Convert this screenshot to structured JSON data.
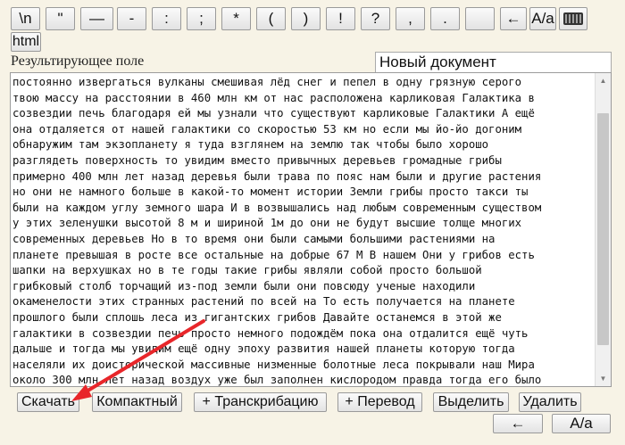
{
  "toolbar": {
    "symbols": [
      "\\n",
      "\"",
      "—",
      "-",
      ":",
      ";",
      "*",
      "(",
      ")",
      "!",
      "?",
      ",",
      ".",
      "",
      "←",
      "A/a"
    ],
    "html_label": "html"
  },
  "result_label": "Результирующее поле",
  "doc_title": "Новый документ",
  "text_lines": [
    "постоянно извергаться вулканы смешивая лёд снег и пепел в одну грязную серого",
    "твою массу на расстоянии в 460 млн км от нас расположена карликовая Галактика в",
    "созвездии печь благодаря ей мы узнали что существуют карликовые Галактики А ещё",
    "она отдаляется от нашей галактики со скоростью 53 км но если мы йо-йо догоним",
    "обнаружим там экзопланету я туда взглянем на землю так чтобы было хорошо",
    "разглядеть поверхность то увидим вместо привычных деревьев громадные грибы",
    "примерно 400 млн лет назад деревья были трава по пояс нам были и другие растения",
    "но они не намного больше в какой-то момент истории Земли грибы просто такси ты",
    "были на каждом углу земного шара И в возвышались над любым современным существом",
    "у этих зеленушки высотой 8 м и шириной 1м до они не будут высшие толще многих",
    "современных деревьев Но в то время они были самыми большими растениями на",
    "планете превышая в росте все остальные на добрые 67 М В нашем Они у грибов есть",
    "шапки на верхушках но в те годы такие грибы являли собой просто большой",
    "грибковый столб торчащий из-под земли были они повсюду ученые находили",
    "окаменелости этих странных растений по всей на То есть получается на планете",
    "прошлого были сплошь леса из гигантских грибов Давайте останемся в этой же",
    "галактики в созвездии печь просто немного подождём пока она отдалится ещё чуть",
    "дальше и тогда мы увидим ещё одну эпоху развития нашей планеты которую тогда",
    "населяли их доисторической массивные низменные болотные леса покрывали наш Мира",
    "около 300 млн лет назад воздух уже был заполнен кислородом правда тогда его было"
  ],
  "actions": {
    "download": "Скачать",
    "compact": "Компактный",
    "transcription": "+ Транскрибацию",
    "translation": "+ Перевод",
    "select": "Выделить",
    "delete": "Удалить"
  },
  "bottom": {
    "back": "←",
    "case": "A/a"
  },
  "colors": {
    "annotation_arrow": "#e8262a"
  }
}
